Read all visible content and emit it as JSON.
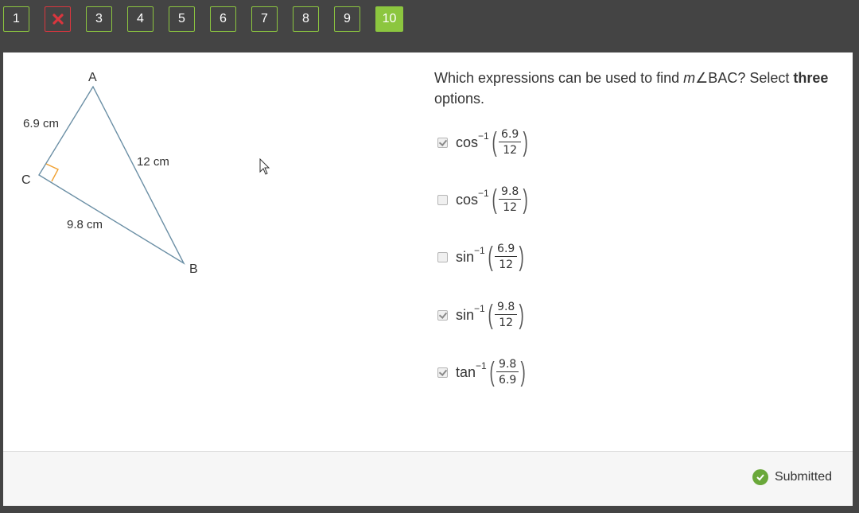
{
  "nav": {
    "buttons": [
      {
        "label": "1",
        "state": "answered"
      },
      {
        "label": "",
        "state": "wrong",
        "icon": "x-icon"
      },
      {
        "label": "3",
        "state": "answered"
      },
      {
        "label": "4",
        "state": "answered"
      },
      {
        "label": "5",
        "state": "answered"
      },
      {
        "label": "6",
        "state": "answered"
      },
      {
        "label": "7",
        "state": "answered"
      },
      {
        "label": "8",
        "state": "answered"
      },
      {
        "label": "9",
        "state": "answered"
      },
      {
        "label": "10",
        "state": "current"
      }
    ],
    "colors": {
      "accent": "#8cc63f",
      "wrong": "#d9363e",
      "bar": "#444444"
    }
  },
  "diagram": {
    "vertices": {
      "a": "A",
      "b": "B",
      "c": "C"
    },
    "sides": {
      "ac": "6.9 cm",
      "ab": "12 cm",
      "cb": "9.8 cm"
    },
    "right_angle_at": "C"
  },
  "question": {
    "text_before": "Which expressions can be used to find ",
    "angle_var": "m",
    "angle_name": "∠BAC",
    "text_after": "? Select ",
    "emphasis": "three",
    "text_end": " options."
  },
  "options": [
    {
      "fn": "cos",
      "sup": "−1",
      "num": "6.9",
      "den": "12",
      "checked": true
    },
    {
      "fn": "cos",
      "sup": "−1",
      "num": "9.8",
      "den": "12",
      "checked": false
    },
    {
      "fn": "sin",
      "sup": "−1",
      "num": "6.9",
      "den": "12",
      "checked": false
    },
    {
      "fn": "sin",
      "sup": "−1",
      "num": "9.8",
      "den": "12",
      "checked": true
    },
    {
      "fn": "tan",
      "sup": "−1",
      "num": "9.8",
      "den": "6.9",
      "checked": true
    }
  ],
  "footer": {
    "status": "Submitted",
    "status_icon": "check-circle-icon"
  }
}
